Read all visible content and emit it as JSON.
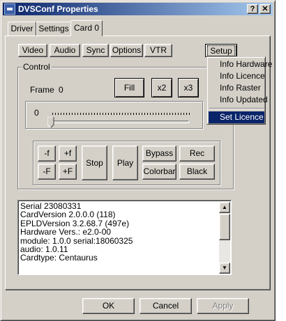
{
  "window": {
    "title": "DVSConf Properties",
    "help_label": "?",
    "close_label": "✕"
  },
  "tabs": [
    {
      "label": "Driver"
    },
    {
      "label": "Settings"
    },
    {
      "label": "Card 0",
      "active": true
    }
  ],
  "subtabs": [
    "Video",
    "Audio",
    "Sync",
    "Options",
    "VTR"
  ],
  "setup_label": "Setup",
  "control": {
    "group_label": "Control",
    "frame_label": "Frame",
    "frame_value": "0",
    "fill_label": "Fill",
    "x2_label": "x2",
    "x3_label": "x3",
    "slider_value": "0"
  },
  "transport": {
    "minus_f": "-f",
    "plus_f": "+f",
    "minus_F": "-F",
    "plus_F": "+F",
    "stop": "Stop",
    "play": "Play",
    "bypass": "Bypass",
    "rec": "Rec",
    "colorbar": "Colorbar",
    "black": "Black"
  },
  "info_lines": [
    "Serial 23080331",
    "CardVersion 2.0.0.0 (118)",
    "EPLDVersion 3.2.68.7 (497e)",
    "Hardware Vers.: e2.0-00",
    "module: 1.0.0  serial:18060325",
    "audio: 1.0.11",
    "Cardtype: Centaurus"
  ],
  "menu": {
    "items": [
      "Info Hardware",
      "Info Licence",
      "Info Raster",
      "Info Updated"
    ],
    "selected_item": "Set Licence"
  },
  "footer": {
    "ok": "OK",
    "cancel": "Cancel",
    "apply": "Apply"
  },
  "icons": {
    "scroll_up": "▲",
    "scroll_down": "▼"
  },
  "colors": {
    "titlebar_start": "#0a246a",
    "titlebar_end": "#a6caf0",
    "face": "#d4d0c8",
    "menu_highlight": "#0a246a"
  }
}
